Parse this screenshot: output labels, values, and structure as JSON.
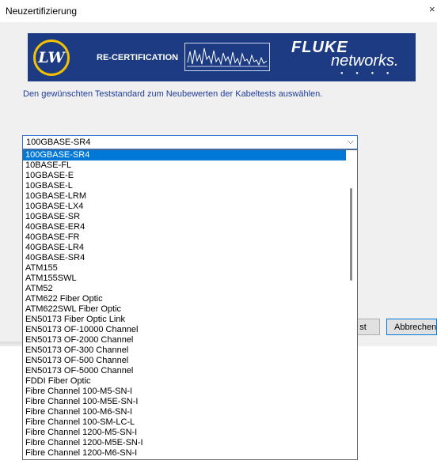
{
  "window": {
    "title": "Neuzertifizierung",
    "close_glyph": "×"
  },
  "banner": {
    "lw_logo": "LW",
    "recert_label": "RE-CERTIFICATION",
    "brand_top": "FLUKE",
    "brand_bottom": "networks."
  },
  "instruction": "Den gewünschten Teststandard zum Neubewerten der Kabeltests auswählen.",
  "combo": {
    "selected": "100GBASE-SR4",
    "chevron_glyph": "⌵"
  },
  "buttons": {
    "test_partial": "st",
    "cancel": "Abbrechen"
  },
  "dropdown": {
    "selected_index": 0,
    "items": [
      "100GBASE-SR4",
      "10BASE-FL",
      "10GBASE-E",
      "10GBASE-L",
      "10GBASE-LRM",
      "10GBASE-LX4",
      "10GBASE-SR",
      "40GBASE-ER4",
      "40GBASE-FR",
      "40GBASE-LR4",
      "40GBASE-SR4",
      "ATM155",
      "ATM155SWL",
      "ATM52",
      "ATM622 Fiber Optic",
      "ATM622SWL Fiber Optic",
      "EN50173 Fiber Optic Link",
      "EN50173 OF-10000 Channel",
      "EN50173 OF-2000 Channel",
      "EN50173 OF-300 Channel",
      "EN50173 OF-500 Channel",
      "EN50173 OF-5000 Channel",
      "FDDI Fiber Optic",
      "Fibre Channel 100-M5-SN-I",
      "Fibre Channel 100-M5E-SN-I",
      "Fibre Channel 100-M6-SN-I",
      "Fibre Channel 100-SM-LC-L",
      "Fibre Channel 1200-M5-SN-I",
      "Fibre Channel 1200-M5E-SN-I",
      "Fibre Channel 1200-M6-SN-I"
    ]
  },
  "colors": {
    "banner": "#1c3b82",
    "selection": "#0078d7",
    "instruction": "#1e3c9c",
    "logo_ring": "#f2c200"
  }
}
